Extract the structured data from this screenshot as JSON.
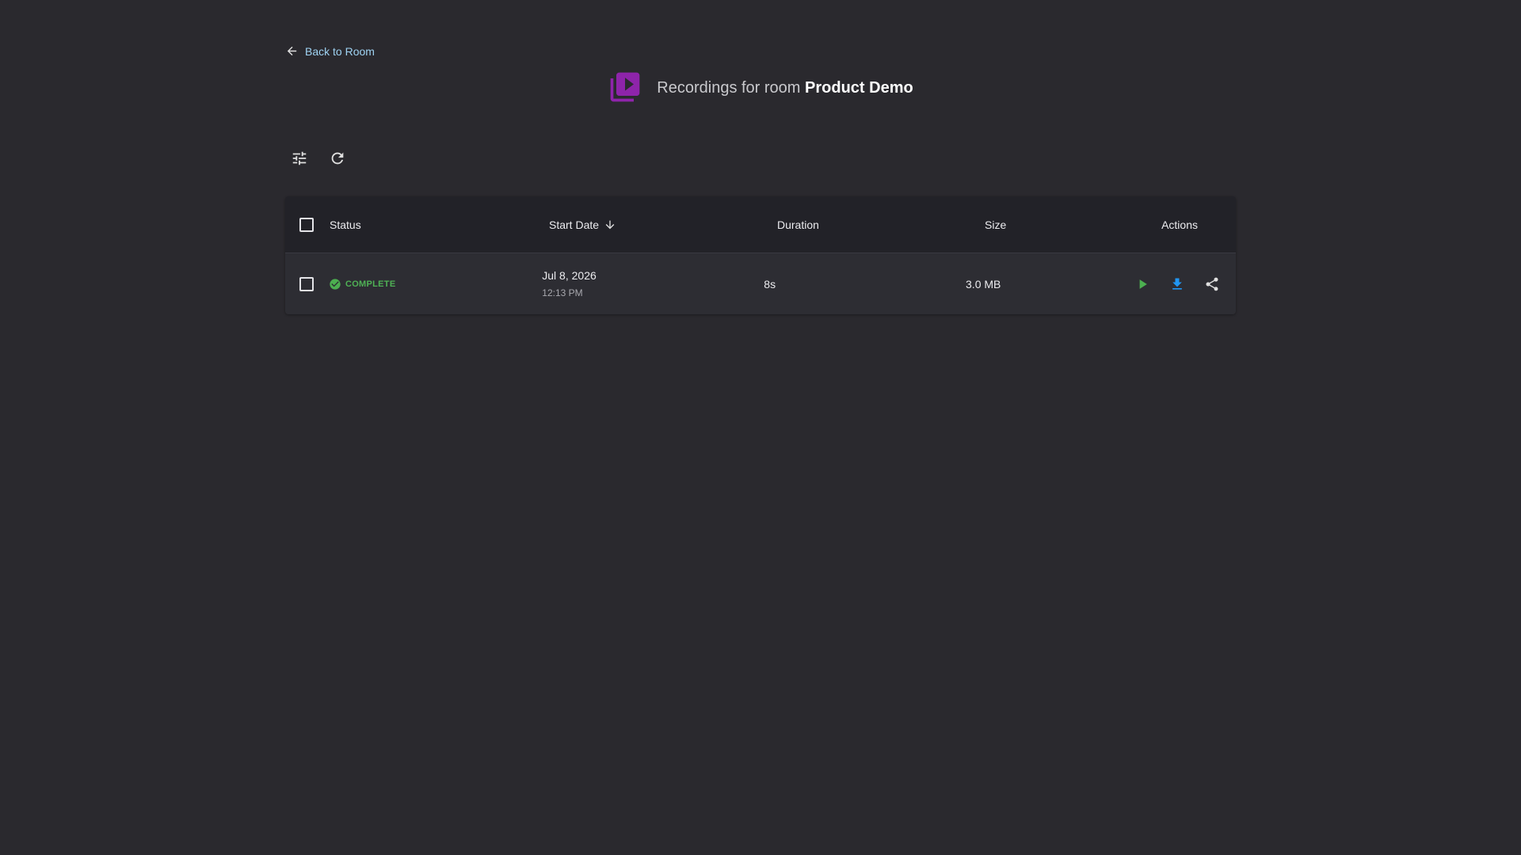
{
  "nav": {
    "back_label": "Back to Room",
    "back_icon": "arrow-left-icon"
  },
  "header": {
    "title_prefix": "Recordings for room",
    "room_name": "Product Demo",
    "logo_icon": "video-library-icon",
    "logo_color": "#8e24aa"
  },
  "toolbar": {
    "filter_icon": "tune-icon",
    "refresh_icon": "refresh-icon"
  },
  "table": {
    "columns": {
      "status": "Status",
      "start_date": "Start Date",
      "duration": "Duration",
      "size": "Size",
      "actions": "Actions"
    },
    "sort": {
      "column": "start_date",
      "direction": "descending"
    },
    "rows": [
      {
        "status": "COMPLETE",
        "status_color": "#4caf50",
        "date": "Jul 8, 2026",
        "time": "12:13 PM",
        "duration": "8s",
        "size": "3.0 MB",
        "actions": [
          "play-icon",
          "download-icon",
          "share-icon"
        ],
        "action_colors": {
          "play": "#4caf50",
          "download": "#2196f3",
          "share": "#e0e0e0"
        }
      }
    ]
  }
}
